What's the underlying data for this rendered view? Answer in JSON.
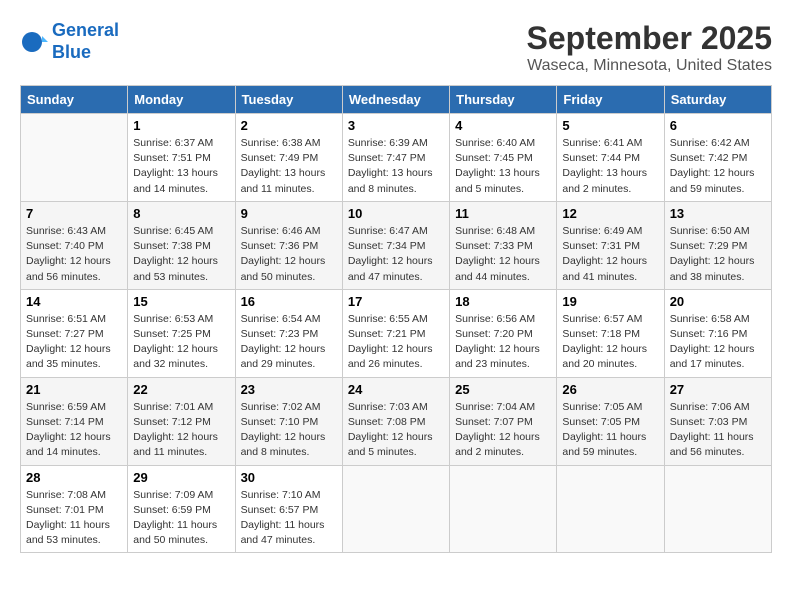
{
  "logo": {
    "line1": "General",
    "line2": "Blue"
  },
  "title": "September 2025",
  "subtitle": "Waseca, Minnesota, United States",
  "days_of_week": [
    "Sunday",
    "Monday",
    "Tuesday",
    "Wednesday",
    "Thursday",
    "Friday",
    "Saturday"
  ],
  "weeks": [
    [
      {
        "day": "",
        "info": ""
      },
      {
        "day": "1",
        "info": "Sunrise: 6:37 AM\nSunset: 7:51 PM\nDaylight: 13 hours\nand 14 minutes."
      },
      {
        "day": "2",
        "info": "Sunrise: 6:38 AM\nSunset: 7:49 PM\nDaylight: 13 hours\nand 11 minutes."
      },
      {
        "day": "3",
        "info": "Sunrise: 6:39 AM\nSunset: 7:47 PM\nDaylight: 13 hours\nand 8 minutes."
      },
      {
        "day": "4",
        "info": "Sunrise: 6:40 AM\nSunset: 7:45 PM\nDaylight: 13 hours\nand 5 minutes."
      },
      {
        "day": "5",
        "info": "Sunrise: 6:41 AM\nSunset: 7:44 PM\nDaylight: 13 hours\nand 2 minutes."
      },
      {
        "day": "6",
        "info": "Sunrise: 6:42 AM\nSunset: 7:42 PM\nDaylight: 12 hours\nand 59 minutes."
      }
    ],
    [
      {
        "day": "7",
        "info": "Sunrise: 6:43 AM\nSunset: 7:40 PM\nDaylight: 12 hours\nand 56 minutes."
      },
      {
        "day": "8",
        "info": "Sunrise: 6:45 AM\nSunset: 7:38 PM\nDaylight: 12 hours\nand 53 minutes."
      },
      {
        "day": "9",
        "info": "Sunrise: 6:46 AM\nSunset: 7:36 PM\nDaylight: 12 hours\nand 50 minutes."
      },
      {
        "day": "10",
        "info": "Sunrise: 6:47 AM\nSunset: 7:34 PM\nDaylight: 12 hours\nand 47 minutes."
      },
      {
        "day": "11",
        "info": "Sunrise: 6:48 AM\nSunset: 7:33 PM\nDaylight: 12 hours\nand 44 minutes."
      },
      {
        "day": "12",
        "info": "Sunrise: 6:49 AM\nSunset: 7:31 PM\nDaylight: 12 hours\nand 41 minutes."
      },
      {
        "day": "13",
        "info": "Sunrise: 6:50 AM\nSunset: 7:29 PM\nDaylight: 12 hours\nand 38 minutes."
      }
    ],
    [
      {
        "day": "14",
        "info": "Sunrise: 6:51 AM\nSunset: 7:27 PM\nDaylight: 12 hours\nand 35 minutes."
      },
      {
        "day": "15",
        "info": "Sunrise: 6:53 AM\nSunset: 7:25 PM\nDaylight: 12 hours\nand 32 minutes."
      },
      {
        "day": "16",
        "info": "Sunrise: 6:54 AM\nSunset: 7:23 PM\nDaylight: 12 hours\nand 29 minutes."
      },
      {
        "day": "17",
        "info": "Sunrise: 6:55 AM\nSunset: 7:21 PM\nDaylight: 12 hours\nand 26 minutes."
      },
      {
        "day": "18",
        "info": "Sunrise: 6:56 AM\nSunset: 7:20 PM\nDaylight: 12 hours\nand 23 minutes."
      },
      {
        "day": "19",
        "info": "Sunrise: 6:57 AM\nSunset: 7:18 PM\nDaylight: 12 hours\nand 20 minutes."
      },
      {
        "day": "20",
        "info": "Sunrise: 6:58 AM\nSunset: 7:16 PM\nDaylight: 12 hours\nand 17 minutes."
      }
    ],
    [
      {
        "day": "21",
        "info": "Sunrise: 6:59 AM\nSunset: 7:14 PM\nDaylight: 12 hours\nand 14 minutes."
      },
      {
        "day": "22",
        "info": "Sunrise: 7:01 AM\nSunset: 7:12 PM\nDaylight: 12 hours\nand 11 minutes."
      },
      {
        "day": "23",
        "info": "Sunrise: 7:02 AM\nSunset: 7:10 PM\nDaylight: 12 hours\nand 8 minutes."
      },
      {
        "day": "24",
        "info": "Sunrise: 7:03 AM\nSunset: 7:08 PM\nDaylight: 12 hours\nand 5 minutes."
      },
      {
        "day": "25",
        "info": "Sunrise: 7:04 AM\nSunset: 7:07 PM\nDaylight: 12 hours\nand 2 minutes."
      },
      {
        "day": "26",
        "info": "Sunrise: 7:05 AM\nSunset: 7:05 PM\nDaylight: 11 hours\nand 59 minutes."
      },
      {
        "day": "27",
        "info": "Sunrise: 7:06 AM\nSunset: 7:03 PM\nDaylight: 11 hours\nand 56 minutes."
      }
    ],
    [
      {
        "day": "28",
        "info": "Sunrise: 7:08 AM\nSunset: 7:01 PM\nDaylight: 11 hours\nand 53 minutes."
      },
      {
        "day": "29",
        "info": "Sunrise: 7:09 AM\nSunset: 6:59 PM\nDaylight: 11 hours\nand 50 minutes."
      },
      {
        "day": "30",
        "info": "Sunrise: 7:10 AM\nSunset: 6:57 PM\nDaylight: 11 hours\nand 47 minutes."
      },
      {
        "day": "",
        "info": ""
      },
      {
        "day": "",
        "info": ""
      },
      {
        "day": "",
        "info": ""
      },
      {
        "day": "",
        "info": ""
      }
    ]
  ]
}
